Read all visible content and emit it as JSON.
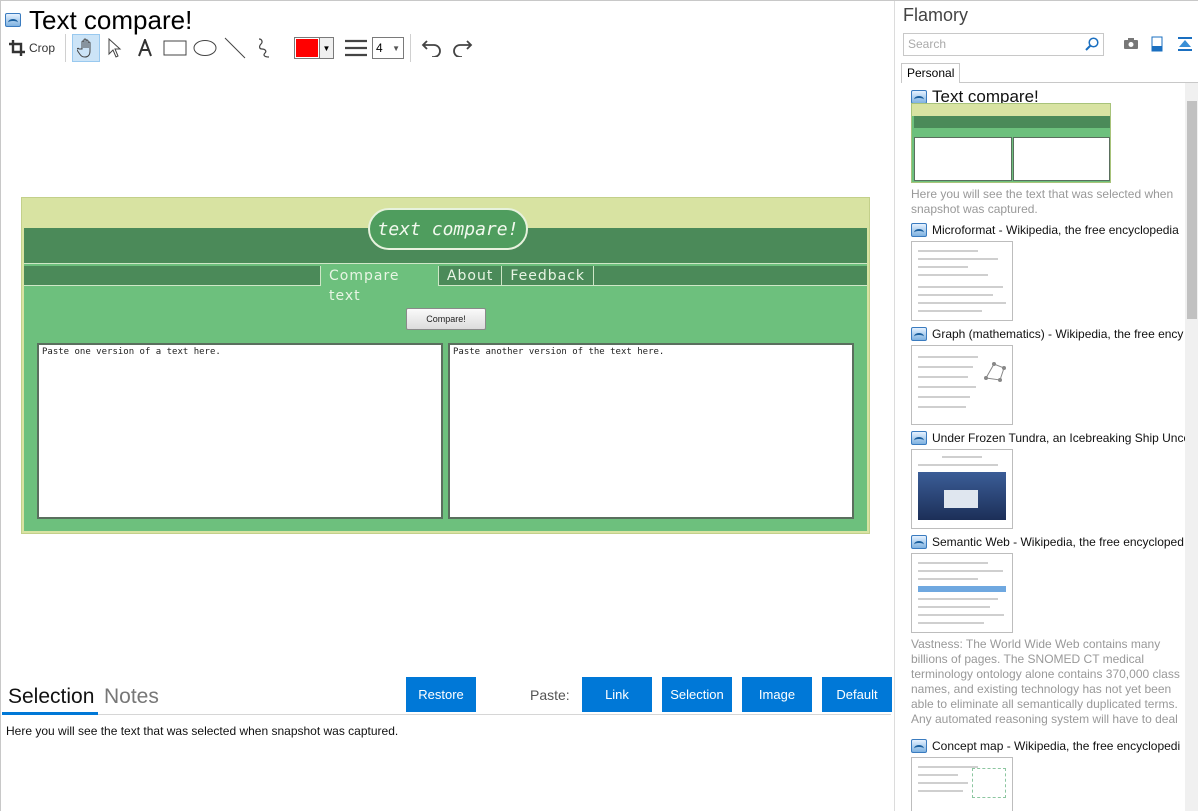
{
  "window": {
    "title": "Text compare!"
  },
  "toolbar": {
    "crop_label": "Crop",
    "line_width": "4",
    "color": "#ff0000",
    "tools": [
      "hand-icon",
      "pointer-icon",
      "text-icon",
      "rectangle-icon",
      "ellipse-icon",
      "line-icon",
      "freehand-icon",
      "undo-icon",
      "redo-icon"
    ]
  },
  "snapshot": {
    "logo": "text compare!",
    "nav": [
      "Compare text",
      "About",
      "Feedback"
    ],
    "compare_button": "Compare!",
    "left_placeholder": "Paste one version of a text here.",
    "right_placeholder": "Paste another version of the text here."
  },
  "bottom": {
    "tab_selection": "Selection",
    "tab_notes": "Notes",
    "restore": "Restore",
    "paste_label": "Paste:",
    "paste_buttons": [
      "Link",
      "Selection",
      "Image",
      "Default"
    ],
    "selection_text": "Here you will see the text that was selected when snapshot was captured."
  },
  "sidebar": {
    "app_name": "Flamory",
    "search_placeholder": "Search",
    "tab": "Personal",
    "items": [
      {
        "title": "Text compare!",
        "desc": "Here you will see the text that was selected when snapshot was captured."
      },
      {
        "title": "Microformat - Wikipedia, the free encyclopedia",
        "desc": ""
      },
      {
        "title": "Graph (mathematics) - Wikipedia, the free ency",
        "desc": ""
      },
      {
        "title": "Under Frozen Tundra, an Icebreaking Ship Unco",
        "desc": ""
      },
      {
        "title": "Semantic Web - Wikipedia, the free encycloped",
        "desc": "Vastness: The World Wide Web contains many billions of pages. The SNOMED CT medical terminology ontology alone contains 370,000 class names, and existing technology has not yet been able to eliminate all semantically duplicated terms. Any automated reasoning system will have to deal with truly huge inputs."
      },
      {
        "title": "Concept map - Wikipedia, the free encyclopedi",
        "desc": ""
      }
    ]
  },
  "colors": {
    "accent": "#0078d7",
    "snapshot_green": "#6dc07d",
    "snapshot_dark_green": "#4b8a59"
  }
}
